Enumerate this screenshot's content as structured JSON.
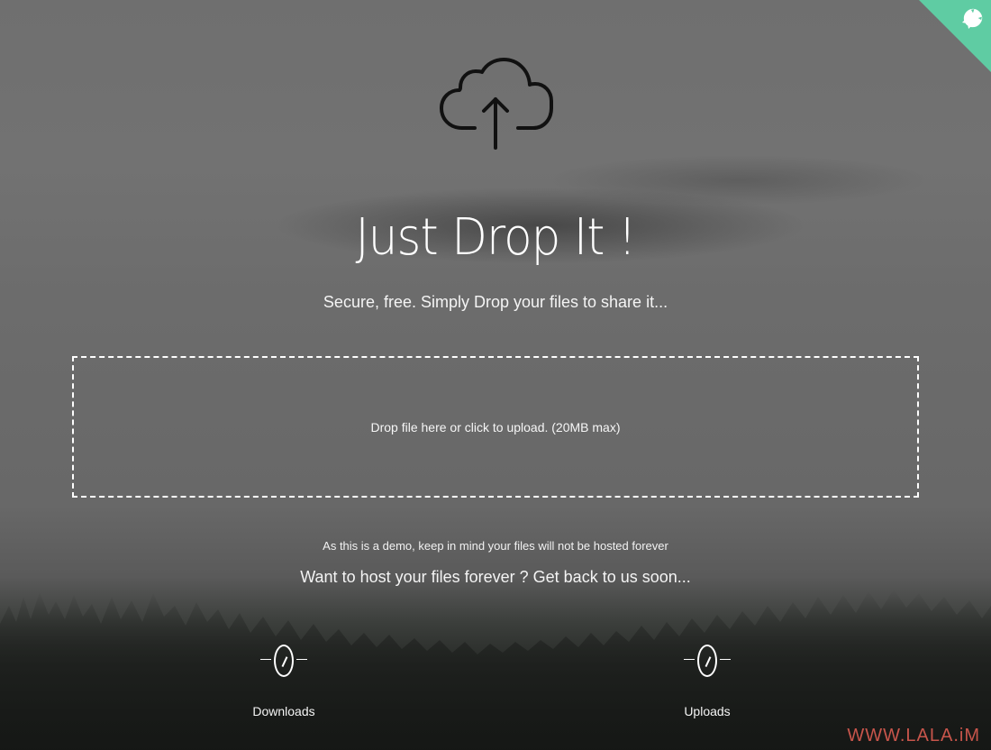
{
  "header": {
    "title": "Just Drop It !",
    "subtitle": "Secure, free. Simply Drop your files to share it..."
  },
  "icons": {
    "hero": "cloud-upload-icon",
    "corner": "github-cat-icon"
  },
  "dropzone": {
    "label": "Drop file here or click to upload. (20MB max)"
  },
  "notes": {
    "demo": "As this is a demo, keep in mind your files will not be hosted forever",
    "host": "Want to host your files forever ? Get back to us soon..."
  },
  "stats": {
    "downloads": {
      "value": "0",
      "label": "Downloads"
    },
    "uploads": {
      "value": "0",
      "label": "Uploads"
    }
  },
  "watermark": "WWW.LALA.iM",
  "colors": {
    "corner_ribbon": "#5fcca3",
    "watermark": "#c7554b"
  }
}
